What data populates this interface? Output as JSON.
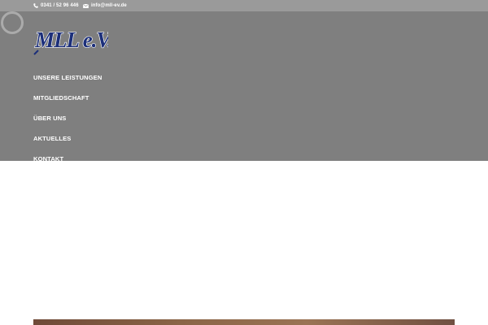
{
  "topbar": {
    "phone_icon": "phone-icon",
    "phone": "0341 / 52 96 446",
    "email_icon": "envelope-icon",
    "email": "info@mll-ev.de"
  },
  "header": {
    "logo_text": "MLL e.V.",
    "nav": [
      {
        "label": "UNSERE LEISTUNGEN"
      },
      {
        "label": "MITGLIEDSCHAFT"
      },
      {
        "label": "ÜBER UNS"
      },
      {
        "label": "AKTUELLES"
      },
      {
        "label": "KONTAKT"
      }
    ]
  },
  "colors": {
    "topbar": "#9a9a9a",
    "header": "#7f7f7f",
    "logo_blue": "#1c2f7a",
    "nav_text": "#ffffff"
  }
}
